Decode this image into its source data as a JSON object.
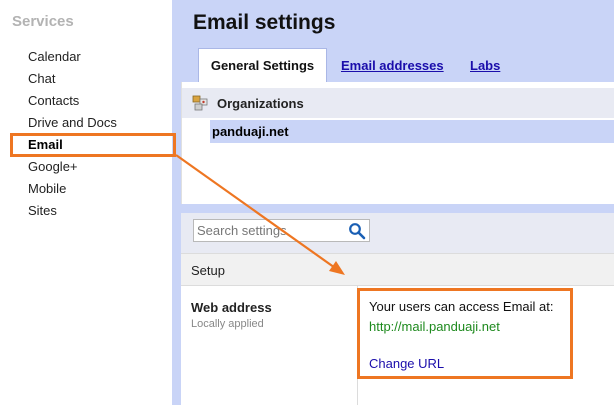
{
  "sidebar": {
    "title": "Services",
    "items": [
      {
        "label": "Calendar"
      },
      {
        "label": "Chat"
      },
      {
        "label": "Contacts"
      },
      {
        "label": "Drive and Docs"
      },
      {
        "label": "Email",
        "active": true
      },
      {
        "label": "Google+"
      },
      {
        "label": "Mobile"
      },
      {
        "label": "Sites"
      }
    ]
  },
  "header": {
    "title": "Email settings",
    "tabs": [
      {
        "label": "General Settings",
        "active": true
      },
      {
        "label": "Email addresses"
      },
      {
        "label": "Labs"
      }
    ]
  },
  "organizations": {
    "title": "Organizations",
    "icon": "org-chart-icon",
    "selected": "panduaji.net"
  },
  "settings": {
    "search_placeholder": "Search settings",
    "search_icon": "search-icon",
    "section": "Setup",
    "web_address": {
      "label": "Web address",
      "sublabel": "Locally applied",
      "description": "Your users can access Email at:",
      "url": "http://mail.panduaji.net",
      "action": "Change URL"
    }
  },
  "colors": {
    "accent_blue": "#c9d4f7",
    "highlight_orange": "#ee7622",
    "link_blue": "#1a0dab",
    "url_green": "#1e8a1e"
  }
}
